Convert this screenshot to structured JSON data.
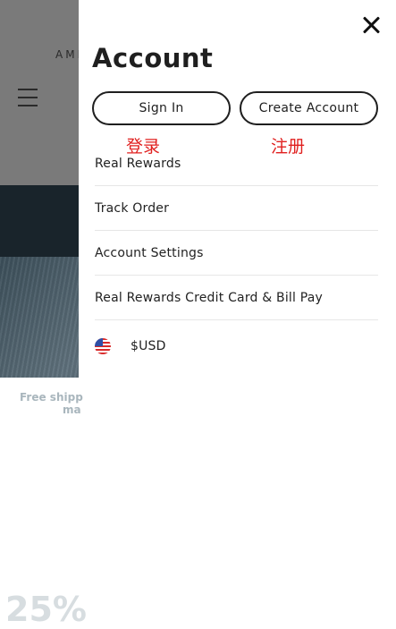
{
  "background": {
    "brand": "AMI",
    "shipping_line1": "Free shipp",
    "shipping_line2": "ma",
    "promo": "25%"
  },
  "drawer": {
    "title": "Account",
    "buttons": {
      "sign_in": "Sign In",
      "create_account": "Create Account"
    },
    "annotations": {
      "sign_in": "登录",
      "create_account": "注册"
    },
    "menu": [
      {
        "label": "Real Rewards"
      },
      {
        "label": "Track Order"
      },
      {
        "label": "Account Settings"
      },
      {
        "label": "Real Rewards Credit Card & Bill Pay"
      }
    ],
    "currency": {
      "label": "$USD",
      "icon": "us-flag-icon"
    }
  },
  "colors": {
    "annotation": "#e0201f",
    "overlay": "#7a7a7a",
    "text": "#1f1f1f"
  }
}
